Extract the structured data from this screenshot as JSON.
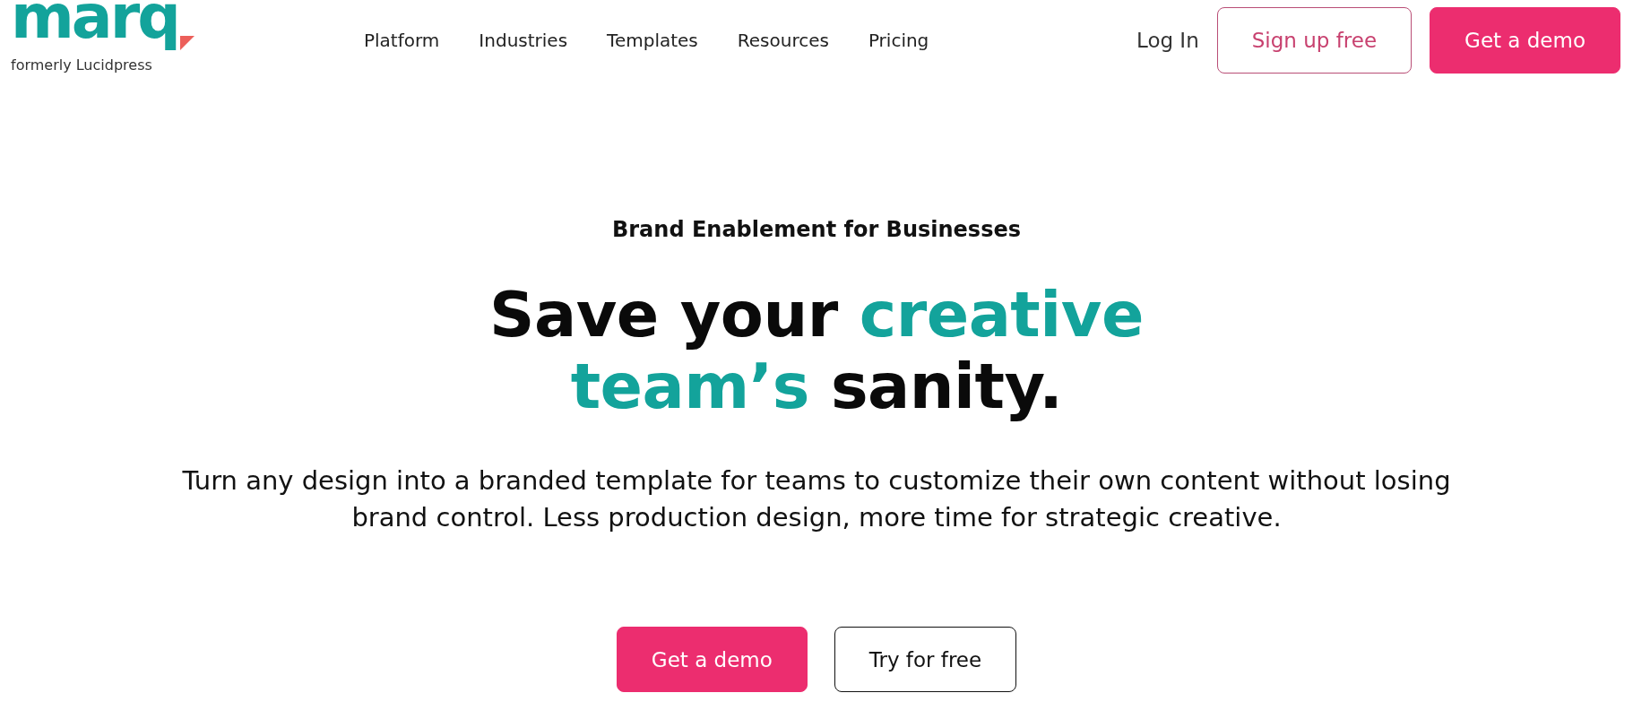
{
  "logo": {
    "wordmark": "marq",
    "tagline": "formerly Lucidpress"
  },
  "nav": {
    "links": [
      "Platform",
      "Industries",
      "Templates",
      "Resources",
      "Pricing"
    ]
  },
  "actions": [
    {
      "label": "Log In",
      "kind": "plain"
    },
    {
      "label": "Sign up free",
      "kind": "outline"
    },
    {
      "label": "Get a demo",
      "kind": "solid"
    }
  ],
  "hero": {
    "eyebrow": "Brand Enablement for Businesses",
    "headline": {
      "lines": [
        [
          {
            "text": "Save your",
            "accent": false
          },
          {
            "text": "creative",
            "accent": true
          }
        ],
        [
          {
            "text": "team’s",
            "accent": true
          },
          {
            "text": "sanity.",
            "accent": false
          }
        ]
      ]
    },
    "description": "Turn any design into a branded template for teams to customize their own content without losing brand control. Less production design, more time for strategic creative.",
    "buttons": [
      {
        "label": "Get a demo",
        "kind": "solid"
      },
      {
        "label": "Try for free",
        "kind": "bordered"
      }
    ]
  }
}
